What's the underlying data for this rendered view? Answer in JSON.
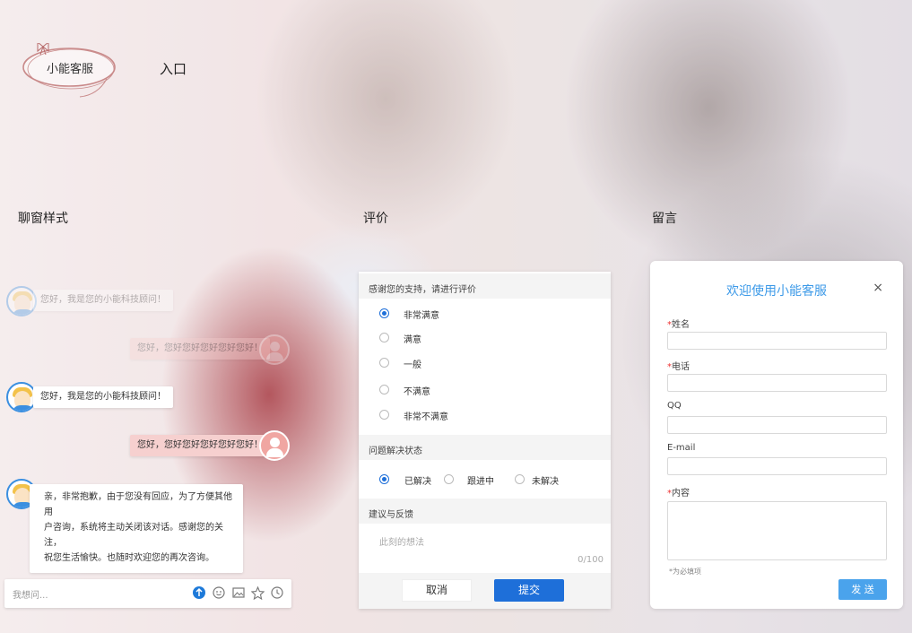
{
  "logo": {
    "text": "小能客服"
  },
  "entry_label": "入口",
  "sections": {
    "chat": "聊窗样式",
    "eval": "评价",
    "msg": "留言"
  },
  "chat": {
    "messages": [
      {
        "text": "您好，我是您的小能科技顾问！",
        "from": "agent",
        "faded": true
      },
      {
        "text": "您好，您好您好您好您好您好！",
        "from": "user",
        "faded": true
      },
      {
        "text": "您好，我是您的小能科技顾问！",
        "from": "agent",
        "faded": false
      },
      {
        "text": "您好，您好您好您好您好您好！",
        "from": "user",
        "faded": false
      },
      {
        "text_lines": [
          "亲，非常抱歉，由于您没有回应，为了方便其他用",
          "户咨询，系统将主动关闭该对话。感谢您的关注，",
          "祝您生活愉快。也随时欢迎您的再次咨询。"
        ],
        "from": "agent"
      }
    ],
    "input_placeholder": "我想问...",
    "tools": [
      "upload-icon",
      "emoji-icon",
      "image-icon",
      "star-icon",
      "clock-icon"
    ]
  },
  "evaluation": {
    "header": "感谢您的支持，请进行评价",
    "options": [
      "非常满意",
      "满意",
      "一般",
      "不满意",
      "非常不满意"
    ],
    "selected": "非常满意",
    "status_header": "问题解决状态",
    "status_options": [
      "已解决",
      "跟进中",
      "未解决"
    ],
    "status_selected": "已解决",
    "suggest_header": "建议与反馈",
    "suggest_placeholder": "此刻的想法",
    "counter": "0/100",
    "cancel": "取消",
    "submit": "提交"
  },
  "message_form": {
    "title": "欢迎使用小能客服",
    "close": "×",
    "fields": [
      {
        "label": "姓名",
        "required": true
      },
      {
        "label": "电话",
        "required": true
      },
      {
        "label": "QQ",
        "required": false
      },
      {
        "label": "E-mail",
        "required": false
      },
      {
        "label": "内容",
        "required": true
      }
    ],
    "required_mark": "*",
    "note": "*为必填项",
    "send": "发 送"
  }
}
